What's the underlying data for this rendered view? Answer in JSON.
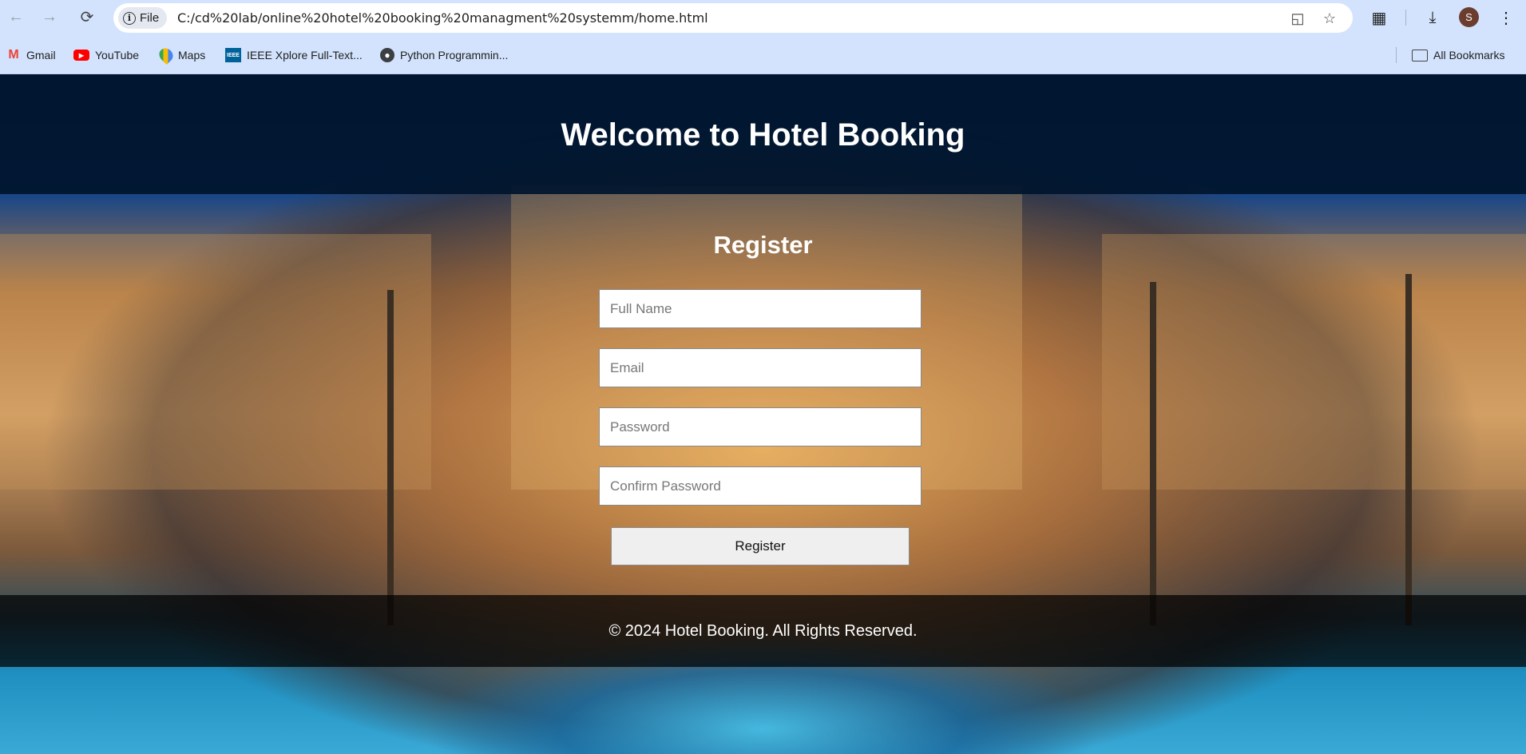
{
  "browser": {
    "url": "C:/cd%20lab/online%20hotel%20booking%20managment%20systemm/home.html",
    "site_chip_label": "File",
    "profile_initial": "S",
    "bookmarks": [
      {
        "label": "Gmail",
        "icon": "gmail-icon"
      },
      {
        "label": "YouTube",
        "icon": "youtube-icon"
      },
      {
        "label": "Maps",
        "icon": "maps-icon"
      },
      {
        "label": "IEEE Xplore Full-Text...",
        "icon": "ieee-icon"
      },
      {
        "label": "Python Programmin...",
        "icon": "globe-icon"
      }
    ],
    "all_bookmarks_label": "All Bookmarks"
  },
  "header": {
    "title": "Welcome to Hotel Booking"
  },
  "register": {
    "title": "Register",
    "full_name_placeholder": "Full Name",
    "email_placeholder": "Email",
    "password_placeholder": "Password",
    "confirm_password_placeholder": "Confirm Password",
    "submit_label": "Register"
  },
  "footer": {
    "text": "© 2024 Hotel Booking. All Rights Reserved."
  },
  "colors": {
    "chrome_bg": "#d3e3fd",
    "header_bg": "#00142d",
    "footer_bg": "#000000"
  }
}
